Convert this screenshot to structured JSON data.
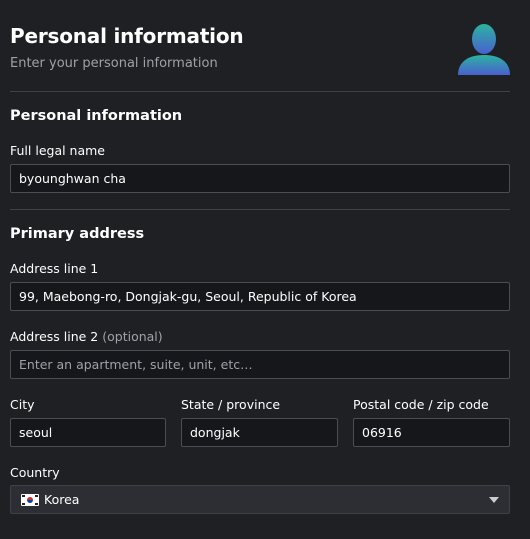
{
  "header": {
    "title": "Personal information",
    "subtitle": "Enter your personal information",
    "avatar_icon": "user-avatar-icon"
  },
  "personal": {
    "section_title": "Personal information",
    "full_name_label": "Full legal name",
    "full_name_value": "byounghwan cha"
  },
  "address": {
    "section_title": "Primary address",
    "line1_label": "Address line 1",
    "line1_value": "99, Maebong-ro, Dongjak-gu, Seoul, Republic of Korea",
    "line2_label": "Address line 2",
    "line2_optional": "(optional)",
    "line2_value": "",
    "line2_placeholder": "Enter an apartment, suite, unit, etc…",
    "city_label": "City",
    "city_value": "seoul",
    "state_label": "State / province",
    "state_value": "dongjak",
    "postal_label": "Postal code / zip code",
    "postal_value": "06916",
    "country_label": "Country",
    "country_value": "Korea",
    "country_flag_icon": "korea-flag-icon"
  },
  "colors": {
    "background": "#1f2023",
    "input_background": "#16171a",
    "select_background": "#2c2e33",
    "muted_text": "#9ea2a8",
    "avatar_gradient_top": "#2bb3a0",
    "avatar_gradient_bottom": "#4a5fd0"
  }
}
